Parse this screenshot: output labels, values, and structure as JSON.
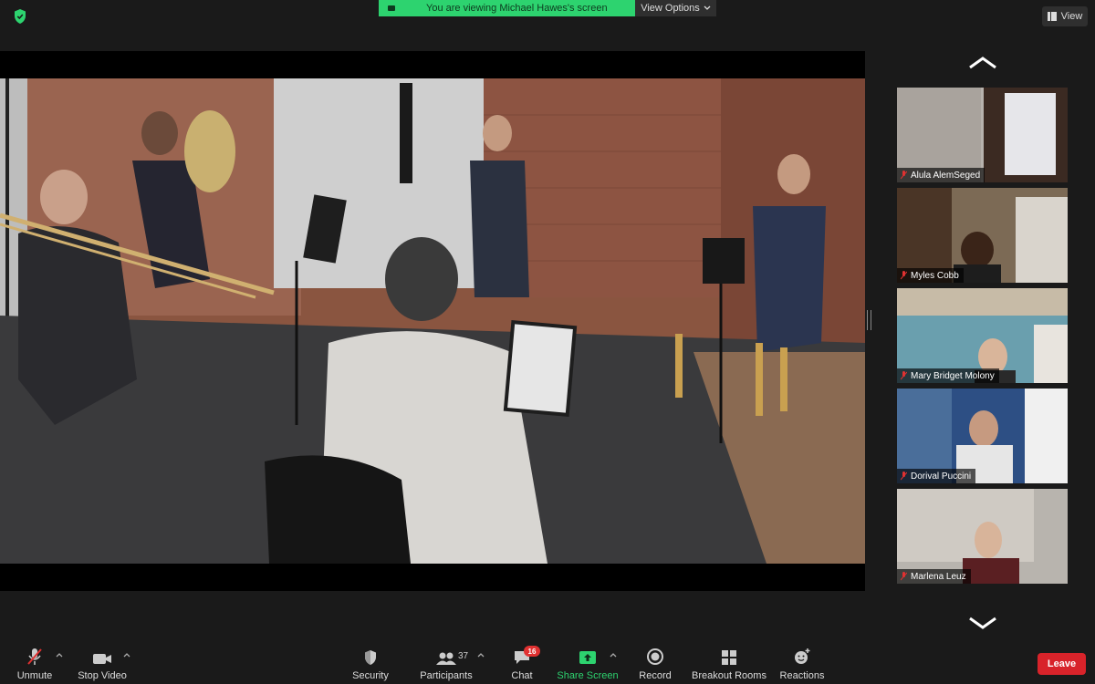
{
  "banner": {
    "text": "You are viewing Michael Hawes's screen",
    "view_options": "View Options"
  },
  "view_button": "View",
  "participants_tiles": [
    {
      "name": "Alula AlemSeged"
    },
    {
      "name": "Myles Cobb"
    },
    {
      "name": "Mary Bridget Molony"
    },
    {
      "name": "Dorival Puccini"
    },
    {
      "name": "Marlena Leuz"
    }
  ],
  "toolbar": {
    "unmute": "Unmute",
    "stop_video": "Stop Video",
    "security": "Security",
    "participants": "Participants",
    "participants_count": "37",
    "chat": "Chat",
    "chat_badge": "16",
    "share_screen": "Share Screen",
    "record": "Record",
    "breakout_rooms": "Breakout Rooms",
    "reactions": "Reactions",
    "leave": "Leave"
  },
  "colors": {
    "accent_green": "#2dd36f",
    "leave_red": "#d8232a",
    "muted_red": "#e03131"
  }
}
